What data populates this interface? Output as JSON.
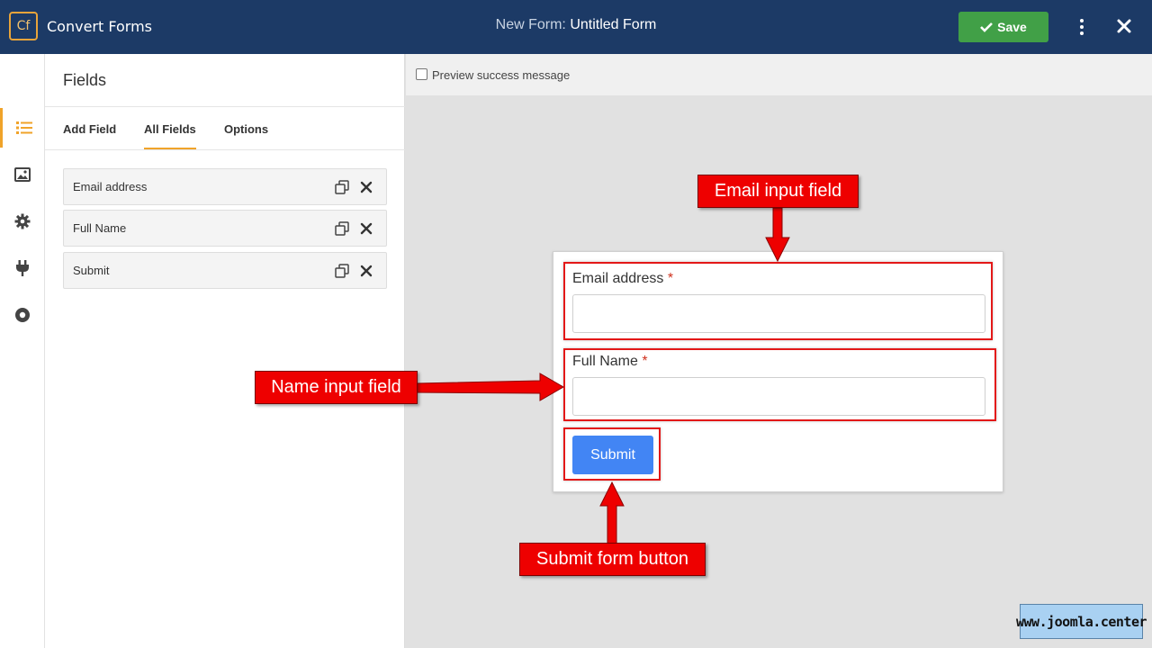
{
  "app": {
    "logo_text": "Cf",
    "name": "Convert Forms",
    "title_prefix": "New Form:",
    "title_name": "Untitled Form",
    "save_label": "Save",
    "accent": "#f0a32a",
    "header_bg": "#1c3a66",
    "save_color": "#41a047"
  },
  "rail": {
    "items": [
      "list-icon",
      "image-icon",
      "gear-icon",
      "plug-icon",
      "circle-dot-icon"
    ],
    "active_index": 0
  },
  "panel": {
    "title": "Fields",
    "tabs": [
      {
        "label": "Add Field",
        "active": false
      },
      {
        "label": "All Fields",
        "active": true
      },
      {
        "label": "Options",
        "active": false
      }
    ],
    "fields": [
      {
        "label": "Email address"
      },
      {
        "label": "Full Name"
      },
      {
        "label": "Submit"
      }
    ]
  },
  "preview": {
    "checkbox_label": "Preview success message",
    "checked": false
  },
  "form": {
    "email_label": "Email address",
    "email_value": "",
    "name_label": "Full Name",
    "name_value": "",
    "required_mark": "*",
    "submit_label": "Submit",
    "submit_color": "#4285f4"
  },
  "annotations": {
    "email_callout": "Email input field",
    "name_callout": "Name input field",
    "submit_callout": "Submit form button",
    "color": "#ee0000"
  },
  "watermark": "www.joomla.center"
}
